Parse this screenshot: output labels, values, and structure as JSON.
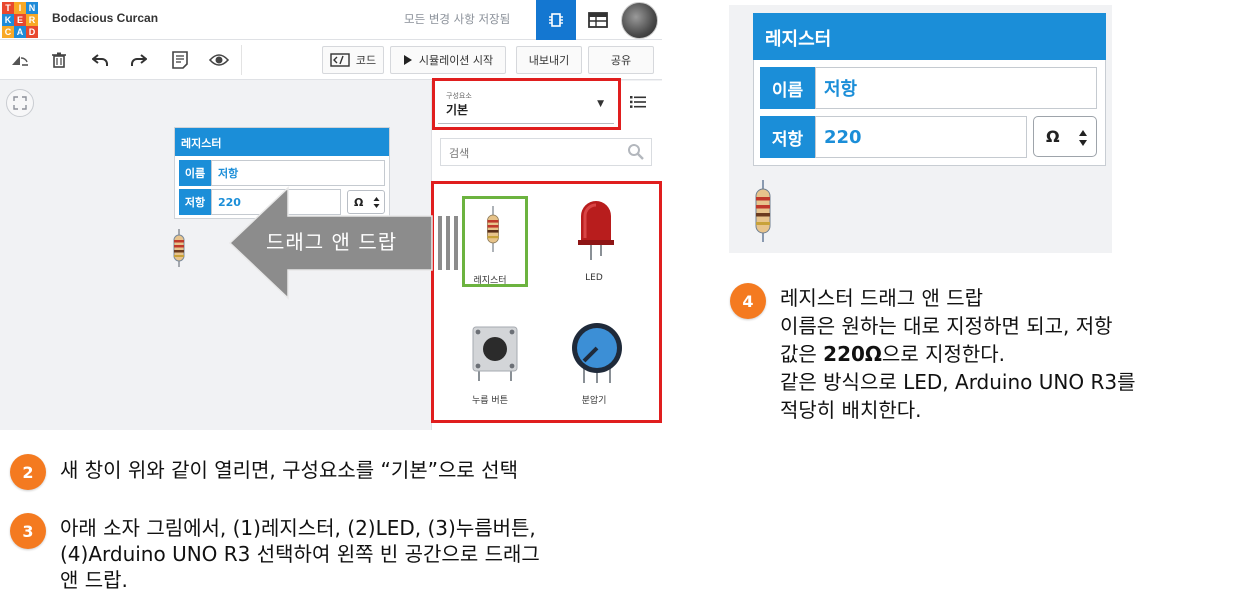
{
  "app": {
    "logo_letters": [
      "T",
      "I",
      "N",
      "K",
      "E",
      "R",
      "C",
      "A",
      "D"
    ],
    "logo_colors": [
      "#e8482e",
      "#f9a825",
      "#1f8bd8",
      "#1f8bd8",
      "#e8482e",
      "#f9a825",
      "#f9a825",
      "#1f8bd8",
      "#e8482e"
    ],
    "project_name": "Bodacious Curcan",
    "save_status": "모든 변경 사항 저장됨"
  },
  "toolbar": {
    "code_label": "코드",
    "simulate_label": "시뮬레이션 시작",
    "export_label": "내보내기",
    "share_label": "공유"
  },
  "component_panel": {
    "select_caption": "구성요소",
    "select_value": "기본",
    "search_placeholder": "검색",
    "components": [
      {
        "label": "레지스터"
      },
      {
        "label": "LED"
      },
      {
        "label": "누름 버튼"
      },
      {
        "label": "분압기"
      }
    ]
  },
  "resistor_card": {
    "title": "레지스터",
    "name_label": "이름",
    "name_value": "저항",
    "resistance_label": "저항",
    "resistance_value": "220",
    "unit": "Ω"
  },
  "drag_arrow_label": "드래그 앤 드랍",
  "steps": {
    "s2": {
      "number": "2",
      "text": "새 창이 위와 같이 열리면, 구성요소를 “기본”으로 선택"
    },
    "s3": {
      "number": "3",
      "line1": "아래 소자 그림에서, (1)레지스터, (2)LED, (3)누름버튼,",
      "line2": "(4)Arduino UNO R3 선택하여 왼쪽 빈 공간으로 드래그",
      "line3": "앤 드랍."
    },
    "s4": {
      "number": "4",
      "line1": "레지스터 드래그 앤 드랍",
      "line2": "이름은 원하는 대로 지정하면 되고, 저항",
      "line3_prefix": "값은 ",
      "line3_bold": "220Ω",
      "line3_suffix": "으로 지정한다.",
      "line4": "같은 방식으로 LED, Arduino UNO R3를",
      "line5": "적당히 배치한다."
    }
  },
  "colors": {
    "accent_blue": "#1b8ed8",
    "highlight_red": "#e01e1e",
    "selection_green": "#6cb33f",
    "badge_orange": "#f47a20"
  }
}
